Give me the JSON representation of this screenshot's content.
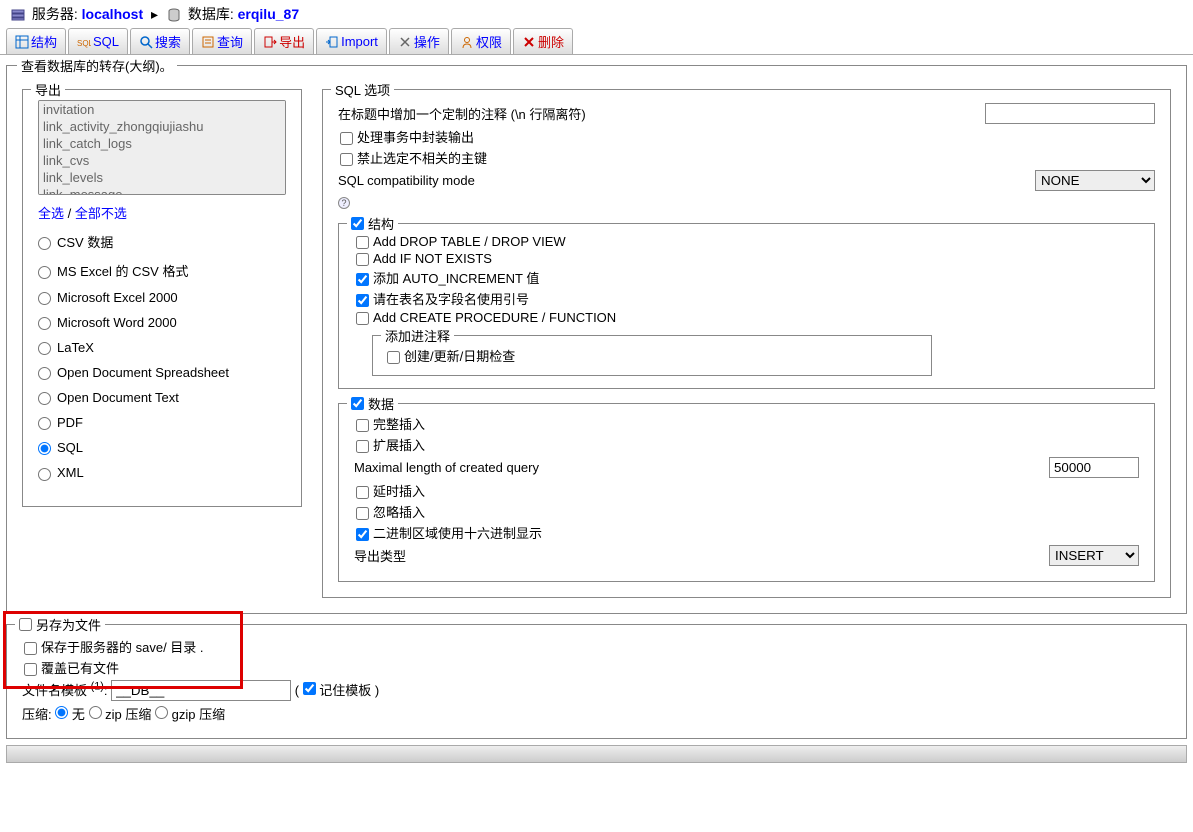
{
  "breadcrumb": {
    "server_label": "服务器:",
    "server_name": "localhost",
    "db_label": "数据库:",
    "db_name": "erqilu_87"
  },
  "tabs": {
    "structure": "结构",
    "sql": "SQL",
    "search": "搜索",
    "query": "查询",
    "export": "导出",
    "import": "Import",
    "operations": "操作",
    "privileges": "权限",
    "drop": "删除"
  },
  "main_title": "查看数据库的转存(大纲)。",
  "export": {
    "legend": "导出",
    "tables": [
      "invitation",
      "link_activity_zhongqiujiashu",
      "link_catch_logs",
      "link_cvs",
      "link_levels",
      "link_message"
    ],
    "select_all": "全选",
    "deselect_all": "全部不选",
    "formats": {
      "csv": "CSV 数据",
      "csv_excel": "MS Excel 的 CSV 格式",
      "excel2000": "Microsoft Excel 2000",
      "word2000": "Microsoft Word 2000",
      "latex": "LaTeX",
      "ods": "Open Document Spreadsheet",
      "odt": "Open Document Text",
      "pdf": "PDF",
      "sql": "SQL",
      "xml": "XML"
    }
  },
  "sql": {
    "legend": "SQL 选项",
    "header_comment": "在标题中增加一个定制的注释 (\\n 行隔离符)",
    "transaction": "处理事务中封装输出",
    "disable_fk": "禁止选定不相关的主键",
    "compat_mode": "SQL compatibility mode",
    "compat_value": "NONE",
    "structure": {
      "legend": "结构",
      "drop_table": "Add DROP TABLE / DROP VIEW",
      "if_not_exists": "Add IF NOT EXISTS",
      "auto_increment": "添加 AUTO_INCREMENT 值",
      "backquotes": "请在表名及字段名使用引号",
      "procedure": "Add CREATE PROCEDURE / FUNCTION",
      "comments_legend": "添加进注释",
      "dates": "创建/更新/日期检查"
    },
    "data": {
      "legend": "数据",
      "complete": "完整插入",
      "extended": "扩展插入",
      "max_len": "Maximal length of created query",
      "max_len_value": "50000",
      "delayed": "延时插入",
      "ignore": "忽略插入",
      "hex_blob": "二进制区域使用十六进制显示",
      "export_type": "导出类型",
      "export_type_value": "INSERT"
    }
  },
  "saveas": {
    "legend": "另存为文件",
    "save_server": "保存于服务器的 save/ 目录 .",
    "overwrite": "覆盖已有文件",
    "template_label": "文件名模板",
    "template_value": "__DB__",
    "remember": "记住模板",
    "compression": "压缩:",
    "none": "无",
    "zip": "zip 压缩",
    "gzip": "gzip 压缩"
  }
}
